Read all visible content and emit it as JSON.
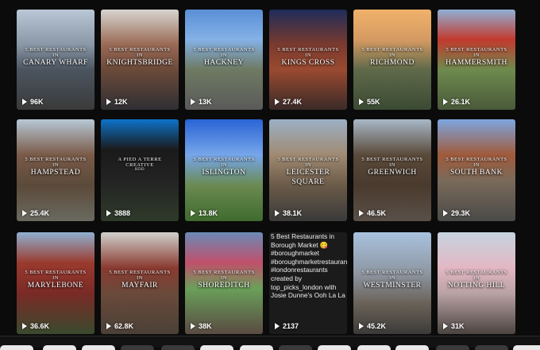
{
  "tiles": [
    {
      "row": 0,
      "col": 0,
      "top": "5 BEST RESTAURANTS",
      "in": "IN",
      "place": "CANARY WHARF",
      "views": "96K"
    },
    {
      "row": 0,
      "col": 1,
      "top": "5 BEST RESTAURANTS",
      "in": "IN",
      "place": "KNIGHTSBRIDGE",
      "views": "12K"
    },
    {
      "row": 0,
      "col": 2,
      "top": "5 BEST RESTAURANTS",
      "in": "IN",
      "place": "HACKNEY",
      "views": "13K"
    },
    {
      "row": 0,
      "col": 3,
      "top": "5 BEST RESTAURANTS",
      "in": "IN",
      "place": "KINGS CROSS",
      "views": "27.4K"
    },
    {
      "row": 0,
      "col": 4,
      "top": "5 BEST RESTAURANTS",
      "in": "IN",
      "place": "RICHMOND",
      "views": "55K"
    },
    {
      "row": 0,
      "col": 5,
      "top": "5 BEST RESTAURANTS",
      "in": "IN",
      "place": "HAMMERSMITH",
      "views": "26.1K"
    },
    {
      "row": 1,
      "col": 0,
      "top": "5 BEST RESTAURANTS",
      "in": "IN",
      "place": "HAMPSTEAD",
      "views": "25.4K"
    },
    {
      "row": 1,
      "col": 1,
      "top": "A PIED A TERRE",
      "in": "CREATIVE",
      "place": "",
      "sub": "HDD",
      "views": "3888"
    },
    {
      "row": 1,
      "col": 2,
      "top": "5 BEST RESTAURANTS",
      "in": "IN",
      "place": "ISLINGTON",
      "views": "13.8K"
    },
    {
      "row": 1,
      "col": 3,
      "top": "5 BEST RESTAURANTS",
      "in": "IN",
      "place": "LEICESTER",
      "place2": "SQUARE",
      "views": "38.1K"
    },
    {
      "row": 1,
      "col": 4,
      "top": "5 BEST RESTAURANTS",
      "in": "IN",
      "place": "GREENWICH",
      "views": "46.5K"
    },
    {
      "row": 1,
      "col": 5,
      "top": "5 BEST RESTAURANTS",
      "in": "IN",
      "place": "SOUTH BANK",
      "views": "29.3K"
    },
    {
      "row": 2,
      "col": 0,
      "top": "5 BEST RESTAURANTS",
      "in": "IN",
      "place": "MARYLEBONE",
      "views": "36.6K"
    },
    {
      "row": 2,
      "col": 1,
      "top": "5 BEST RESTAURANTS",
      "in": "IN",
      "place": "MAYFAIR",
      "views": "62.8K"
    },
    {
      "row": 2,
      "col": 2,
      "top": "5 BEST RESTAURANTS",
      "in": "IN",
      "place": "SHOREDITCH",
      "views": "38K"
    },
    {
      "row": 2,
      "col": 3,
      "text": true,
      "desc": "5 Best Restaurants in Borough Market 😋 #boroughmarket #boroughmarketrestaurants #londonrestaurants created by top_picks_london with Josie Dunne's Ooh La La",
      "views": "2137"
    },
    {
      "row": 2,
      "col": 4,
      "top": "5 BEST RESTAURANTS",
      "in": "IN",
      "place": "WESTMINSTER",
      "views": "45.2K"
    },
    {
      "row": 2,
      "col": 5,
      "top": "5 BEST RESTAURANTS",
      "in": "IN",
      "place": "NOTTING HILL",
      "views": "31K"
    }
  ],
  "colors": {
    "accent": "#ff2d55",
    "background": "#0b0b0b"
  }
}
